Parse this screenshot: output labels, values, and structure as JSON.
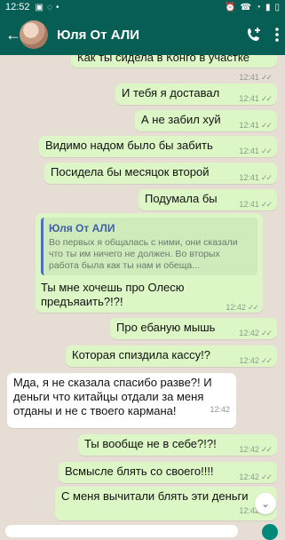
{
  "status_bar": {
    "time": "12:52"
  },
  "header": {
    "back_icon": "arrow-left-icon",
    "title": "Юля От АЛИ"
  },
  "messages": [
    {
      "dir": "out",
      "text": "Как ты сидела в Конго в участке",
      "time": "12:41"
    },
    {
      "dir": "out",
      "text": "И тебя я доставал",
      "time": "12:41"
    },
    {
      "dir": "out",
      "text": "А не забил хуй",
      "time": "12:41"
    },
    {
      "dir": "out",
      "text": "Видимо надом было бы забить",
      "time": "12:41"
    },
    {
      "dir": "out",
      "text": "Посидела бы месяцок второй",
      "time": "12:41"
    },
    {
      "dir": "out",
      "text": "Подумала бы",
      "time": "12:41"
    },
    {
      "dir": "out",
      "quote_name": "Юля От АЛИ",
      "quote_text": "Во первых я общалась с ними, они сказали что ты им ничего не должен. Во вторых работа была как ты нам и обеща...",
      "text": "Ты мне хочешь про Олесю предъяаить?!?!",
      "time": "12:42"
    },
    {
      "dir": "out",
      "text": "Про ебаную мышь",
      "time": "12:42"
    },
    {
      "dir": "out",
      "text": "Которая спиздила кассу!?",
      "time": "12:42"
    },
    {
      "dir": "in",
      "text": "Мда, я не сказала спасибо разве?! И деньги что китайцы отдали за меня отданы и не с твоего кармана!",
      "time": "12:42"
    },
    {
      "dir": "out",
      "text": "Ты вообще не в себе?!?!",
      "time": "12:42"
    },
    {
      "dir": "out",
      "text": "Всмысле блять со своего!!!!",
      "time": "12:42"
    },
    {
      "dir": "out",
      "text": "С меня вычитали блять эти деньги",
      "time": "12:42"
    }
  ],
  "colors": {
    "header": "#075e54",
    "outgoing": "#dcf7c5",
    "incoming": "#ffffff",
    "wallpaper": "#e6ddd4"
  }
}
